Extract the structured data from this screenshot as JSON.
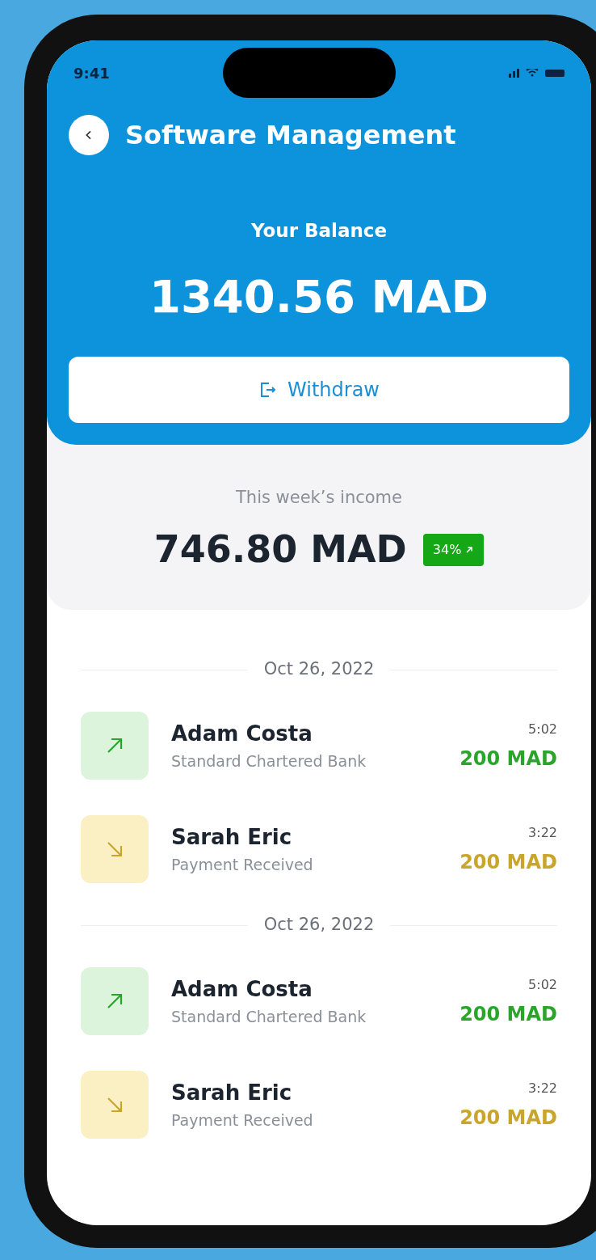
{
  "status_bar": {
    "time": "9:41"
  },
  "header": {
    "title": "Software Management"
  },
  "balance": {
    "label": "Your Balance",
    "amount": "1340.56 MAD",
    "button": "Withdraw"
  },
  "income": {
    "label": "This week’s income",
    "amount": "746.80 MAD",
    "badge": "34%"
  },
  "groups": [
    {
      "date": "Oct 26, 2022",
      "transactions": [
        {
          "kind": "up",
          "name": "Adam Costa",
          "detail": "Standard Chartered Bank",
          "time": "5:02",
          "amount": "200 MAD"
        },
        {
          "kind": "down",
          "name": "Sarah Eric",
          "detail": "Payment Received",
          "time": "3:22",
          "amount": "200 MAD"
        }
      ]
    },
    {
      "date": "Oct 26, 2022",
      "transactions": [
        {
          "kind": "up",
          "name": "Adam Costa",
          "detail": "Standard Chartered Bank",
          "time": "5:02",
          "amount": "200 MAD"
        },
        {
          "kind": "down",
          "name": "Sarah Eric",
          "detail": "Payment Received",
          "time": "3:22",
          "amount": "200 MAD"
        }
      ]
    }
  ]
}
